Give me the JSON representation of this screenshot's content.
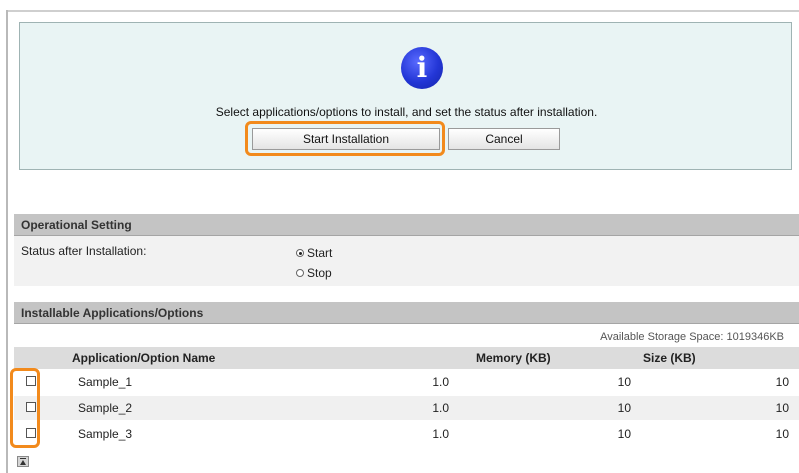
{
  "dialog": {
    "message": "Select applications/options to install, and set the status after installation.",
    "start_label": "Start Installation",
    "cancel_label": "Cancel",
    "icon": "info-icon"
  },
  "operational": {
    "title": "Operational Setting",
    "status_label": "Status after Installation:",
    "options": [
      {
        "label": "Start",
        "selected": true
      },
      {
        "label": "Stop",
        "selected": false
      }
    ]
  },
  "installable": {
    "title": "Installable Applications/Options",
    "storage": "Available Storage Space: 1019346KB",
    "columns": [
      "Application/Option Name",
      "Memory (KB)",
      "Size (KB)"
    ],
    "rows": [
      {
        "name": "Sample_1",
        "version": "1.0",
        "memory": "10",
        "size": "10",
        "checked": false
      },
      {
        "name": "Sample_2",
        "version": "1.0",
        "memory": "10",
        "size": "10",
        "checked": false
      },
      {
        "name": "Sample_3",
        "version": "1.0",
        "memory": "10",
        "size": "10",
        "checked": false
      }
    ]
  },
  "colors": {
    "highlight": "#f28a1c",
    "dialog_bg": "#e9f4f4",
    "section_header": "#c4c4c4",
    "info_icon": "#2336d6"
  }
}
